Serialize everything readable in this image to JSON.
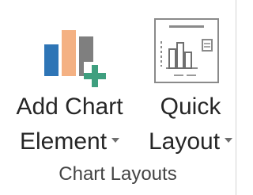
{
  "ribbon_group": {
    "label": "Chart Layouts",
    "buttons": {
      "add_chart_element": {
        "label_line1": "Add Chart",
        "label_line2": "Element",
        "icon": "add-chart-element-icon",
        "has_dropdown": true
      },
      "quick_layout": {
        "label_line1": "Quick",
        "label_line2": "Layout",
        "icon": "quick-layout-icon",
        "has_dropdown": true
      }
    }
  },
  "colors": {
    "bar_blue": "#2e75b6",
    "bar_orange": "#f4b183",
    "bar_gray": "#7f7f7f",
    "plus_green": "#3f9f7f",
    "text": "#262626",
    "separator": "#d4d4d4"
  }
}
